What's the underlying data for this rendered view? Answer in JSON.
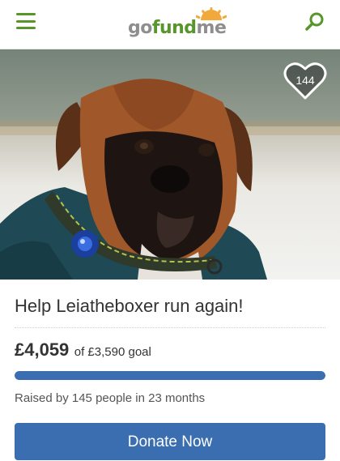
{
  "header": {
    "logo": {
      "go": "go",
      "fund": "fund",
      "me": "me"
    },
    "menu_icon": "hamburger-menu-icon",
    "search_icon": "search-icon"
  },
  "hero": {
    "image": "photo of a boxer dog wearing a teal coat and collar",
    "heart_icon": "heart-icon",
    "heart_count": "144"
  },
  "campaign": {
    "title": "Help Leiatheboxer run again!",
    "raised": "£4,059",
    "goal_text": "of £3,590 goal",
    "progress_fraction": 1.0,
    "raised_by": "Raised by 145 people in 23 months",
    "donate_label": "Donate Now"
  },
  "colors": {
    "brand_green": "#56962a",
    "progress_blue": "#3a6eb0",
    "donate_blue": "#3a6eb0"
  }
}
